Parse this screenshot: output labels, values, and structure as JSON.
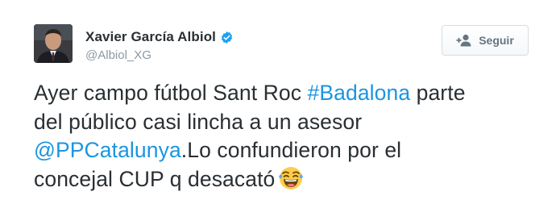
{
  "user": {
    "display_name": "Xavier García Albiol",
    "handle": "@Albiol_XG",
    "avatar_icon": "profile-photo",
    "verified_icon": "verified-badge-icon"
  },
  "follow_button": {
    "label": "Seguir",
    "icon": "add-user-icon"
  },
  "tweet": {
    "line1_text": "Ayer campo fútbol Sant Roc ",
    "line1_hashtag": "#Badalona",
    "line1_tail": " parte",
    "line2_text": "del público casi lincha a un asesor",
    "line3_mention": "@PPCatalunya",
    "line3_text": ".Lo confundieron por el",
    "line4_text": "concejal CUP q desacató",
    "emoji": "face-with-tears-of-joy"
  },
  "colors": {
    "link": "#1b95e0",
    "text": "#292f33",
    "muted": "#8899a6",
    "verified": "#1da1f2"
  }
}
